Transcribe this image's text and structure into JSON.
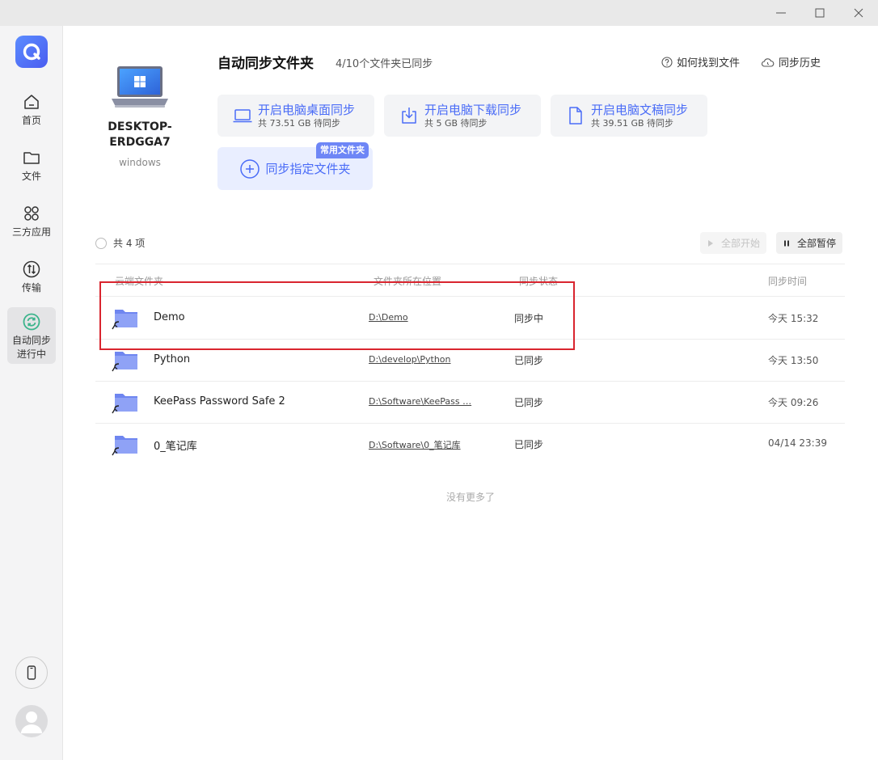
{
  "window": {
    "controls": [
      "minimize-icon",
      "maximize-icon",
      "close-icon"
    ]
  },
  "sidebar": {
    "logo": "cloud-logo-icon",
    "items": [
      {
        "label": "首页",
        "icon": "home-icon"
      },
      {
        "label": "文件",
        "icon": "folder-icon"
      },
      {
        "label": "三方应用",
        "icon": "apps-grid-icon"
      },
      {
        "label": "传输",
        "icon": "transfer-icon"
      },
      {
        "label": "自动同步\n进行中",
        "label_line1": "自动同步",
        "label_line2": "进行中",
        "icon": "sync-icon",
        "active": true
      }
    ],
    "bottom": [
      "phone-icon",
      "avatar-icon"
    ]
  },
  "device": {
    "name": "DESKTOP-ERDGGA7",
    "name_line1": "DESKTOP-",
    "name_line2": "ERDGGA7",
    "os": "windows",
    "icon": "laptop-windows-icon"
  },
  "header": {
    "title": "自动同步文件夹",
    "subtitle": "4/10个文件夹已同步",
    "help_link": "如何找到文件",
    "history_link": "同步历史"
  },
  "cards": [
    {
      "title": "开启电脑桌面同步",
      "sub": "共 73.51 GB 待同步",
      "icon": "laptop-icon"
    },
    {
      "title": "开启电脑下载同步",
      "sub": "共 5 GB 待同步",
      "icon": "download-icon"
    },
    {
      "title": "开启电脑文稿同步",
      "sub": "共 39.51 GB 待同步",
      "icon": "document-icon"
    }
  ],
  "custom_card": {
    "label": "同步指定文件夹",
    "badge": "常用文件夹",
    "icon": "plus-circle-icon"
  },
  "list": {
    "count": "共 4 项",
    "start_all": "全部开始",
    "pause_all": "全部暂停",
    "columns": {
      "name": "云端文件夹",
      "location": "文件夹所在位置",
      "status": "同步状态",
      "time": "同步时间"
    },
    "rows": [
      {
        "name": "Demo",
        "path": "D:\\Demo",
        "status": "同步中",
        "time": "今天 15:32"
      },
      {
        "name": "Python",
        "path": "D:\\develop\\Python",
        "status": "已同步",
        "time": "今天 13:50"
      },
      {
        "name": "KeePass Password Safe 2",
        "path": "D:\\Software\\KeePass …",
        "status": "已同步",
        "time": "今天 09:26"
      },
      {
        "name": "0_笔记库",
        "path": "D:\\Software\\0_笔记库",
        "status": "已同步",
        "time": "04/14 23:39"
      }
    ],
    "footer": "没有更多了"
  },
  "colors": {
    "accent": "#4a6cf7",
    "highlight_box": "#d9252f",
    "sync_active": "#3cb48c"
  }
}
